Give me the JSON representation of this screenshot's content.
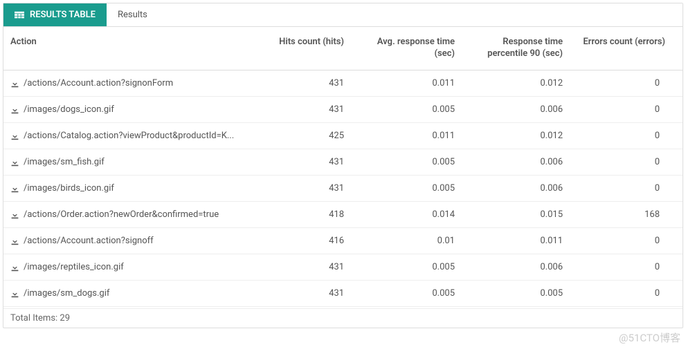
{
  "tabs": {
    "active_label": "RESULTS TABLE",
    "inactive_label": "Results"
  },
  "columns": {
    "action": "Action",
    "hits": "Hits count (hits)",
    "avg": "Avg. response time (sec)",
    "p90": "Response time percentile 90 (sec)",
    "err": "Errors count (errors)"
  },
  "rows": [
    {
      "action": "/actions/Account.action?signonForm",
      "hits": "431",
      "avg": "0.011",
      "p90": "0.012",
      "err": "0"
    },
    {
      "action": "/images/dogs_icon.gif",
      "hits": "431",
      "avg": "0.005",
      "p90": "0.006",
      "err": "0"
    },
    {
      "action": "/actions/Catalog.action?viewProduct&productId=K...",
      "hits": "425",
      "avg": "0.011",
      "p90": "0.012",
      "err": "0"
    },
    {
      "action": "/images/sm_fish.gif",
      "hits": "431",
      "avg": "0.005",
      "p90": "0.006",
      "err": "0"
    },
    {
      "action": "/images/birds_icon.gif",
      "hits": "431",
      "avg": "0.005",
      "p90": "0.006",
      "err": "0"
    },
    {
      "action": "/actions/Order.action?newOrder&confirmed=true",
      "hits": "418",
      "avg": "0.014",
      "p90": "0.015",
      "err": "168"
    },
    {
      "action": "/actions/Account.action?signoff",
      "hits": "416",
      "avg": "0.01",
      "p90": "0.011",
      "err": "0"
    },
    {
      "action": "/images/reptiles_icon.gif",
      "hits": "431",
      "avg": "0.005",
      "p90": "0.006",
      "err": "0"
    },
    {
      "action": "/images/sm_dogs.gif",
      "hits": "431",
      "avg": "0.005",
      "p90": "0.005",
      "err": "0"
    }
  ],
  "footer": {
    "total_label": "Total Items: 29"
  },
  "watermark": "@51CTO博客"
}
